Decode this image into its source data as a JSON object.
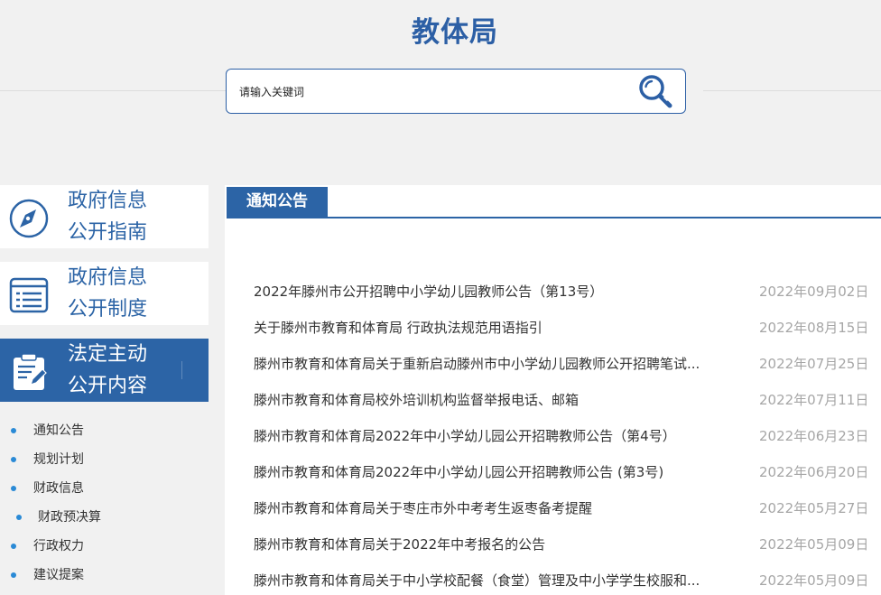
{
  "header": {
    "title": "教体局"
  },
  "search": {
    "placeholder": "请输入关键词"
  },
  "sidebar": {
    "blocks": [
      {
        "line1": "政府信息",
        "line2": "公开指南",
        "icon": "compass-icon"
      },
      {
        "line1": "政府信息",
        "line2": "公开制度",
        "icon": "list-document-icon"
      },
      {
        "line1": "法定主动",
        "line2": "公开内容",
        "icon": "clipboard-edit-icon"
      }
    ],
    "sub_items": [
      {
        "label": "通知公告"
      },
      {
        "label": "规划计划"
      },
      {
        "label": "财政信息"
      },
      {
        "label": "财政预决算"
      },
      {
        "label": "行政权力"
      },
      {
        "label": "建议提案"
      }
    ]
  },
  "main": {
    "tab_label": "通知公告",
    "news": [
      {
        "title": "2022年滕州市公开招聘中小学幼儿园教师公告（第13号）",
        "date": "2022年09月02日"
      },
      {
        "title": "关于滕州市教育和体育局 行政执法规范用语指引",
        "date": "2022年08月15日"
      },
      {
        "title": "滕州市教育和体育局关于重新启动滕州市中小学幼儿园教师公开招聘笔试...",
        "date": "2022年07月25日"
      },
      {
        "title": "滕州市教育和体育局校外培训机构监督举报电话、邮箱",
        "date": "2022年07月11日"
      },
      {
        "title": "滕州市教育和体育局2022年中小学幼儿园公开招聘教师公告（第4号）",
        "date": "2022年06月23日"
      },
      {
        "title": "滕州市教育和体育局2022年中小学幼儿园公开招聘教师公告 (第3号)",
        "date": "2022年06月20日"
      },
      {
        "title": "滕州市教育和体育局关于枣庄市外中考考生返枣备考提醒",
        "date": "2022年05月27日"
      },
      {
        "title": "滕州市教育和体育局关于2022年中考报名的公告",
        "date": "2022年05月09日"
      },
      {
        "title": "滕州市教育和体育局关于中小学校配餐（食堂）管理及中小学学生校服和...",
        "date": "2022年05月09日"
      }
    ]
  },
  "colors": {
    "brand": "#2c64a6",
    "title": "#2c5fa5",
    "dot": "#2a8ad6",
    "date": "#a6a6a6",
    "background": "#f1f1f1"
  }
}
